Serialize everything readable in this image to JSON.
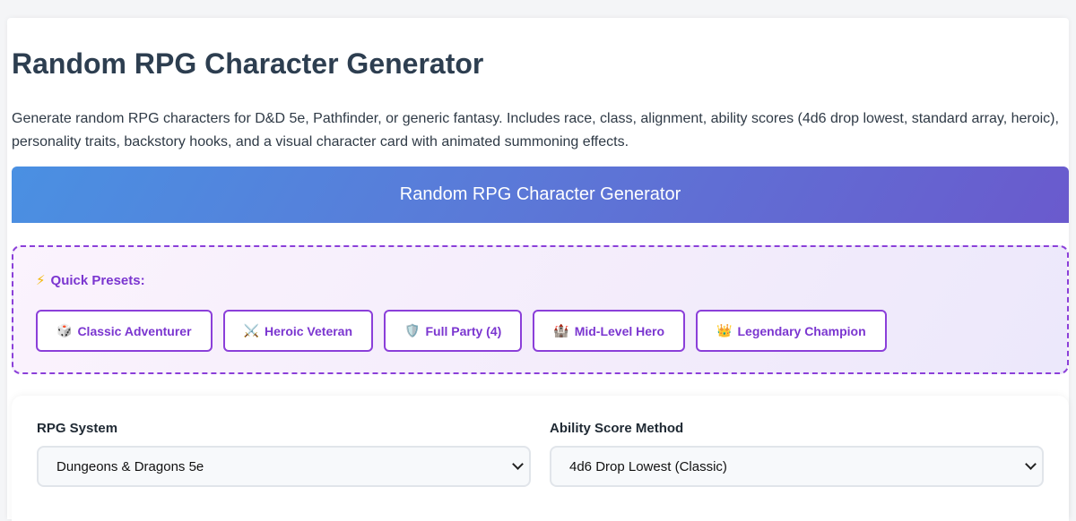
{
  "page": {
    "title": "Random RPG Character Generator",
    "description": "Generate random RPG characters for D&D 5e, Pathfinder, or generic fantasy. Includes race, class, alignment, ability scores (4d6 drop lowest, standard array, heroic), personality traits, backstory hooks, and a visual character card with animated summoning effects."
  },
  "banner": {
    "title": "Random RPG Character Generator"
  },
  "presets": {
    "heading_icon": "⚡",
    "heading": "Quick Presets:",
    "items": [
      {
        "icon": "🎲",
        "icon_name": "dice-icon",
        "label": "Classic Adventurer"
      },
      {
        "icon": "⚔️",
        "icon_name": "crossed-swords-icon",
        "label": "Heroic Veteran"
      },
      {
        "icon": "🛡️",
        "icon_name": "shield-icon",
        "label": "Full Party (4)"
      },
      {
        "icon": "🏰",
        "icon_name": "castle-icon",
        "label": "Mid-Level Hero"
      },
      {
        "icon": "👑",
        "icon_name": "crown-icon",
        "label": "Legendary Champion"
      }
    ]
  },
  "options": {
    "rpg_system": {
      "label": "RPG System",
      "value": "Dungeons & Dragons 5e"
    },
    "ability_method": {
      "label": "Ability Score Method",
      "value": "4d6 Drop Lowest (Classic)"
    }
  },
  "colors": {
    "accent": "#8b3fd9",
    "title": "#2d3e50",
    "banner_start": "#4a90e2",
    "banner_end": "#6a5acd"
  }
}
